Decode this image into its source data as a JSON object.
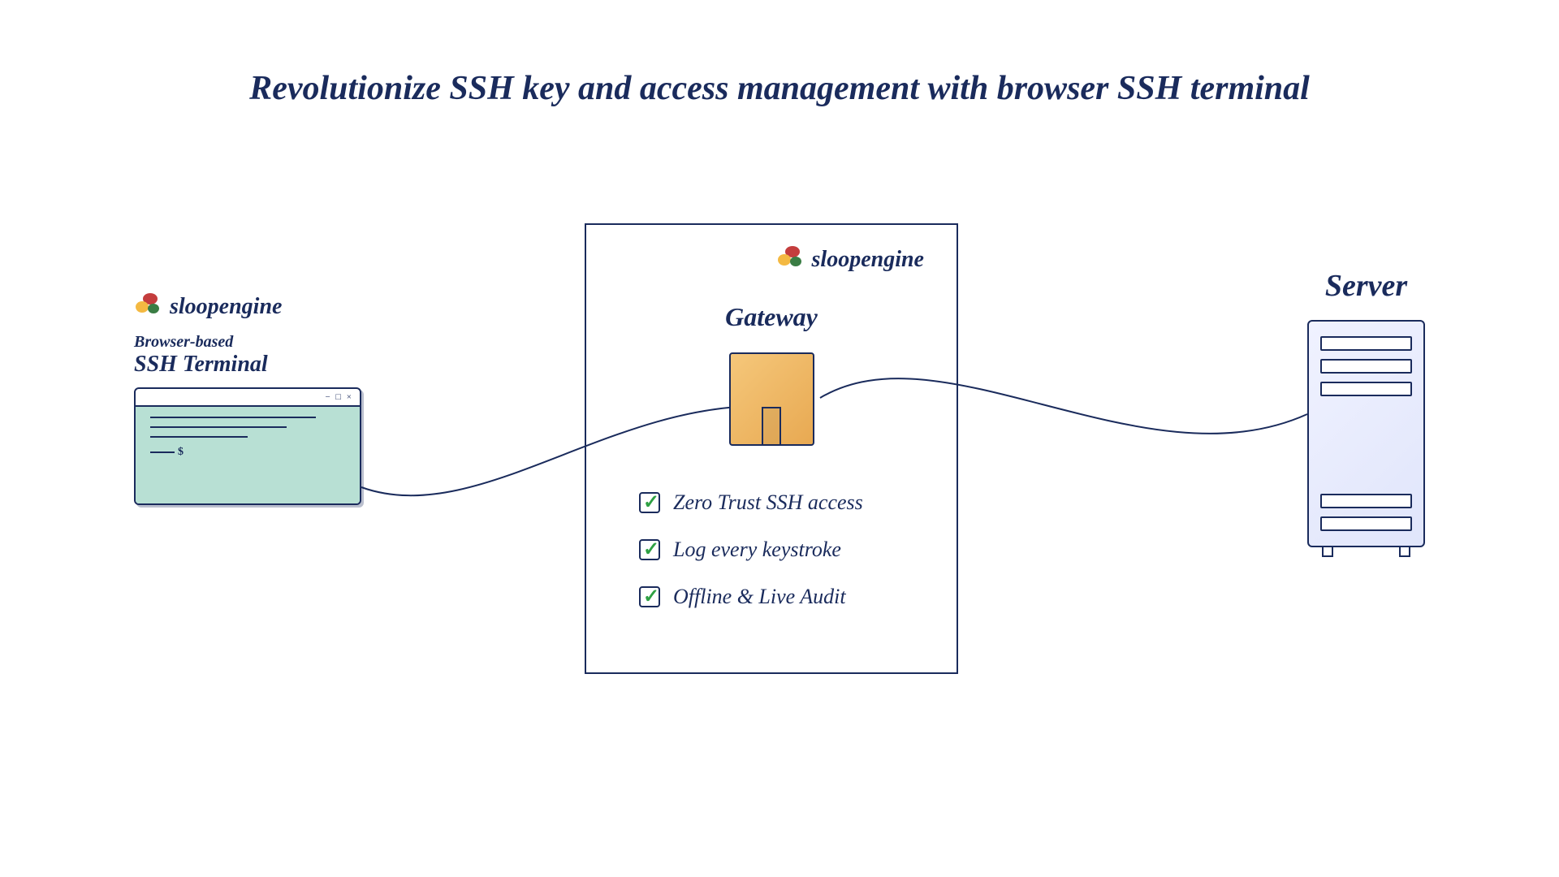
{
  "title": "Revolutionize SSH key and access management with browser SSH terminal",
  "brand": "sloopengine",
  "terminal": {
    "browser_based": "Browser-based",
    "label": "SSH Terminal",
    "window_controls": "− □ ×",
    "prompt": "$"
  },
  "gateway": {
    "title": "Gateway",
    "features": [
      "Zero Trust SSH access",
      "Log every keystroke",
      "Offline & Live Audit"
    ]
  },
  "server": {
    "label": "Server"
  },
  "colors": {
    "primary": "#1a2b5c",
    "terminal_bg": "#b8e0d4",
    "gateway_fill": "#f5c77a",
    "check": "#2ea043"
  }
}
